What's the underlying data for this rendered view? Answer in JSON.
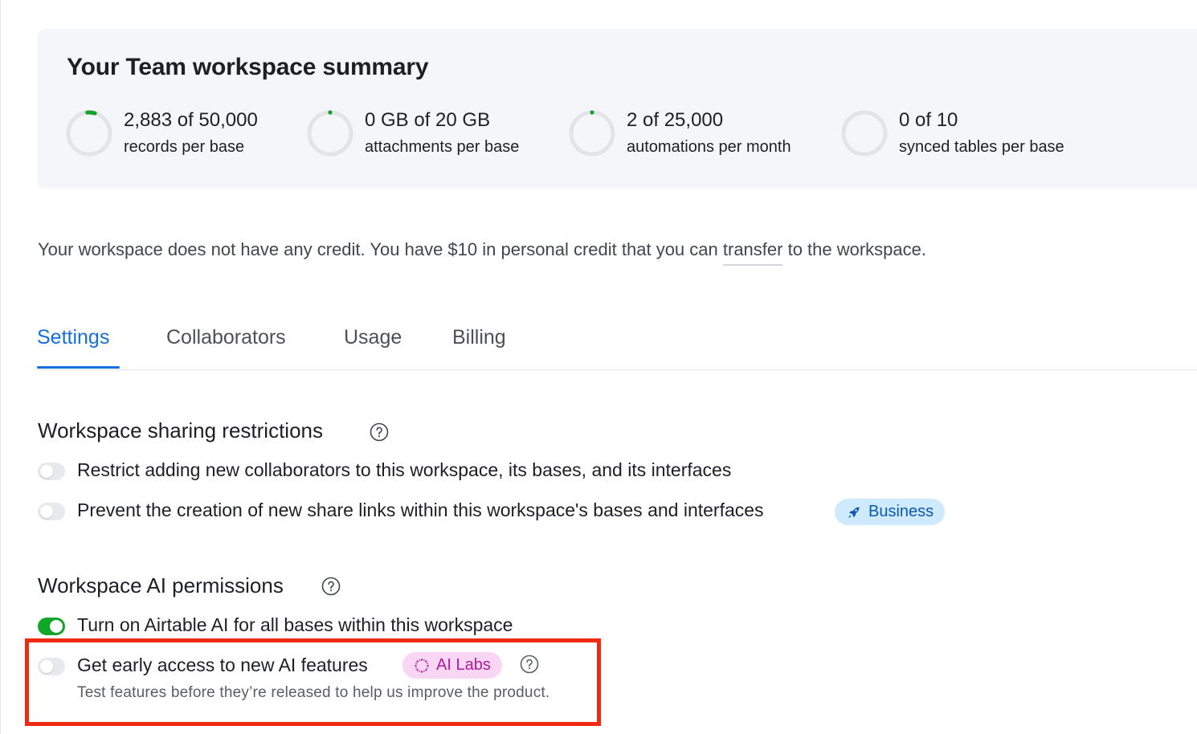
{
  "summary": {
    "title": "Your Team workspace summary",
    "metrics": [
      {
        "value": "2,883 of 50,000",
        "label": "records per base",
        "fraction": 0.058
      },
      {
        "value": "0 GB of 20 GB",
        "label": "attachments per base",
        "fraction": 0.0
      },
      {
        "value": "2 of 25,000",
        "label": "automations per month",
        "fraction": 0.0001
      },
      {
        "value": "0 of 10",
        "label": "synced tables per base",
        "fraction": 0.0
      }
    ]
  },
  "credit": {
    "before": "Your workspace does not have any credit. You have $10 in personal credit that you can ",
    "link": "transfer",
    "after": " to the workspace."
  },
  "tabs": {
    "settings": "Settings",
    "collaborators": "Collaborators",
    "usage": "Usage",
    "billing": "Billing",
    "active": "settings"
  },
  "sharing": {
    "title": "Workspace sharing restrictions",
    "restrict_label": "Restrict adding new collaborators to this workspace, its bases, and its interfaces",
    "restrict_on": false,
    "prevent_label": "Prevent the creation of new share links within this workspace's bases and interfaces",
    "prevent_on": false,
    "badge": "Business"
  },
  "ai": {
    "title": "Workspace AI permissions",
    "turn_on_label": "Turn on Airtable AI for all bases within this workspace",
    "turn_on_on": true,
    "early_label": "Get early access to new AI features",
    "early_on": false,
    "badge": "AI Labs",
    "early_desc": "Test features before they’re released to help us improve the product."
  },
  "colors": {
    "accent": "#166ee1",
    "toggle_on": "#11a82a",
    "ring_progress": "#12a12a",
    "ring_track": "#e3e4e8",
    "highlight": "#ee2a12"
  }
}
